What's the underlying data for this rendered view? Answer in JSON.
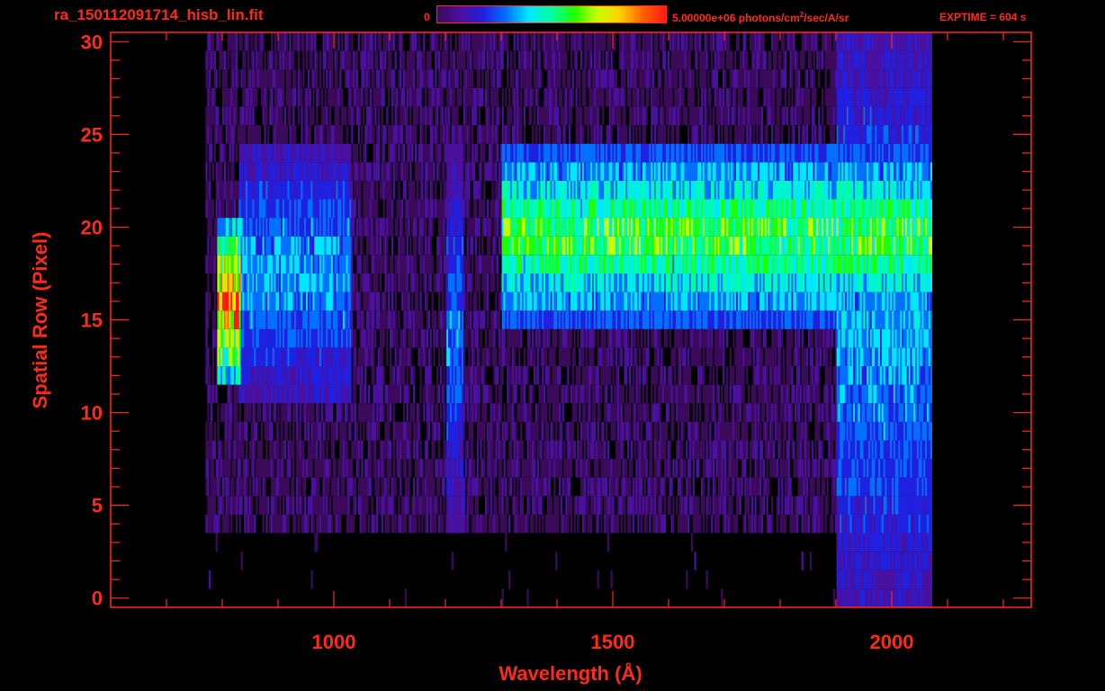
{
  "header": {
    "filename": "ra_150112091714_hisb_lin.fit",
    "colorbar_min": "0",
    "colorbar_max": "5.00000e+06 photons/cm",
    "colorbar_max_sup": "2",
    "colorbar_max_suffix": "/sec/A/sr",
    "exptime": "EXPTIME = 604 s"
  },
  "colors": {
    "axis": "#ff2a1a",
    "background": "#000000",
    "colormap": [
      "#000000",
      "#3c0a5a",
      "#4a10a0",
      "#2020e0",
      "#0070ff",
      "#00e8ff",
      "#00ffa0",
      "#20ff00",
      "#c8ff00",
      "#ffd000",
      "#ff6000",
      "#ff1818"
    ]
  },
  "chart_data": {
    "type": "heatmap",
    "title": "ra_150112091714_hisb_lin.fit",
    "xlabel": "Wavelength (Å)",
    "ylabel": "Spatial Row (Pixel)",
    "xlim": [
      600,
      2250
    ],
    "ylim": [
      -0.5,
      30.5
    ],
    "x_ticks": [
      1000,
      1500,
      2000
    ],
    "x_tick_labels": [
      "1000",
      "1500",
      "2000"
    ],
    "y_ticks": [
      0,
      5,
      10,
      15,
      20,
      25,
      30
    ],
    "y_tick_labels": [
      "0",
      "5",
      "10",
      "15",
      "20",
      "25",
      "30"
    ],
    "colorbar_range": [
      0,
      5000000
    ],
    "data_x_range": [
      770,
      2070
    ],
    "data_y_range": [
      4,
      30
    ],
    "features": [
      {
        "wavelength_range": [
          790,
          830
        ],
        "rows": [
          12,
          20
        ],
        "peak_fraction": 1.0
      },
      {
        "wavelength_range": [
          830,
          1030
        ],
        "rows": [
          11,
          24
        ],
        "peak_fraction": 0.45
      },
      {
        "wavelength_range": [
          1200,
          1230
        ],
        "rows": [
          4,
          24
        ],
        "peak_fraction": 0.4
      },
      {
        "wavelength_range": [
          1300,
          2070
        ],
        "rows": [
          15,
          24
        ],
        "peak_fraction": 0.7
      },
      {
        "wavelength_range": [
          1900,
          2070
        ],
        "rows": [
          0,
          30
        ],
        "peak_fraction": 0.45
      }
    ]
  }
}
